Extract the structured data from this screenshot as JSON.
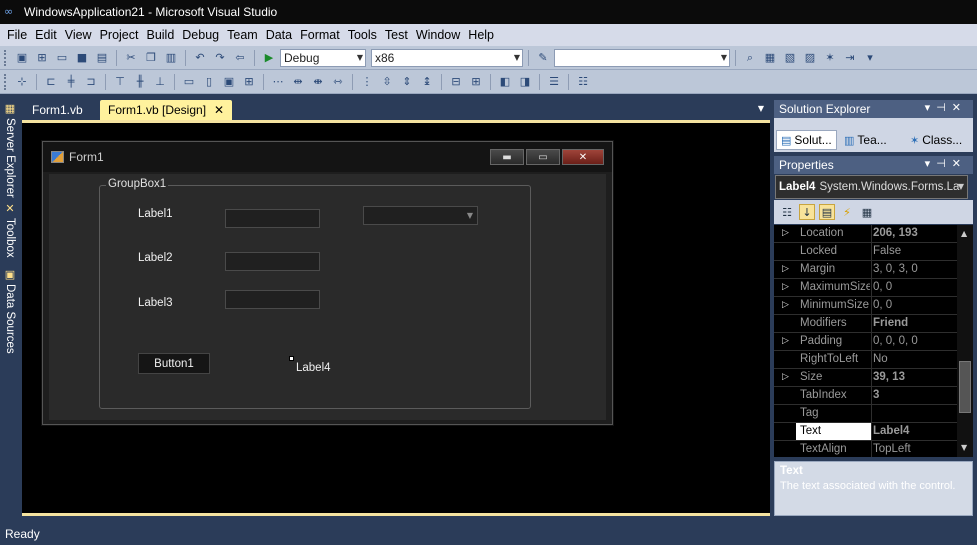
{
  "window": {
    "title": "WindowsApplication21 - Microsoft Visual Studio"
  },
  "menu": [
    "File",
    "Edit",
    "View",
    "Project",
    "Build",
    "Debug",
    "Team",
    "Data",
    "Format",
    "Tools",
    "Test",
    "Window",
    "Help"
  ],
  "toolbar": {
    "configuration": "Debug",
    "platform": "x86",
    "search_value": ""
  },
  "left_tool_windows": [
    "Server Explorer",
    "Toolbox",
    "Data Sources"
  ],
  "doc_tabs": [
    {
      "label": "Form1.vb",
      "active": false
    },
    {
      "label": "Form1.vb [Design]",
      "active": true
    }
  ],
  "designer": {
    "form_title": "Form1",
    "groupbox_title": "GroupBox1",
    "labels": [
      "Label1",
      "Label2",
      "Label3"
    ],
    "button_text": "Button1",
    "selected_label": "Label4"
  },
  "solution_explorer": {
    "title": "Solution Explorer",
    "tabs": [
      "Solut...",
      "Tea...",
      "Class..."
    ]
  },
  "properties": {
    "title": "Properties",
    "object_name": "Label4",
    "object_type": "System.Windows.Forms.La",
    "rows": [
      {
        "name": "Location",
        "value": "206, 193",
        "bold": true,
        "expandable": true
      },
      {
        "name": "Locked",
        "value": "False",
        "bold": false,
        "expandable": false
      },
      {
        "name": "Margin",
        "value": "3, 0, 3, 0",
        "bold": false,
        "expandable": true
      },
      {
        "name": "MaximumSize",
        "value": "0, 0",
        "bold": false,
        "expandable": true
      },
      {
        "name": "MinimumSize",
        "value": "0, 0",
        "bold": false,
        "expandable": true
      },
      {
        "name": "Modifiers",
        "value": "Friend",
        "bold": true,
        "expandable": false
      },
      {
        "name": "Padding",
        "value": "0, 0, 0, 0",
        "bold": false,
        "expandable": true
      },
      {
        "name": "RightToLeft",
        "value": "No",
        "bold": false,
        "expandable": false
      },
      {
        "name": "Size",
        "value": "39, 13",
        "bold": true,
        "expandable": true
      },
      {
        "name": "TabIndex",
        "value": "3",
        "bold": true,
        "expandable": false
      },
      {
        "name": "Tag",
        "value": "",
        "bold": false,
        "expandable": false
      },
      {
        "name": "Text",
        "value": "Label4",
        "bold": true,
        "expandable": false,
        "selected": true
      },
      {
        "name": "TextAlign",
        "value": "TopLeft",
        "bold": false,
        "expandable": false
      }
    ],
    "description_title": "Text",
    "description_text": "The text associated with the control."
  },
  "status": {
    "text": "Ready"
  },
  "colors": {
    "accent_tab": "#fff29d",
    "chrome": "#2b3c59",
    "designer_bg": "#000000"
  }
}
